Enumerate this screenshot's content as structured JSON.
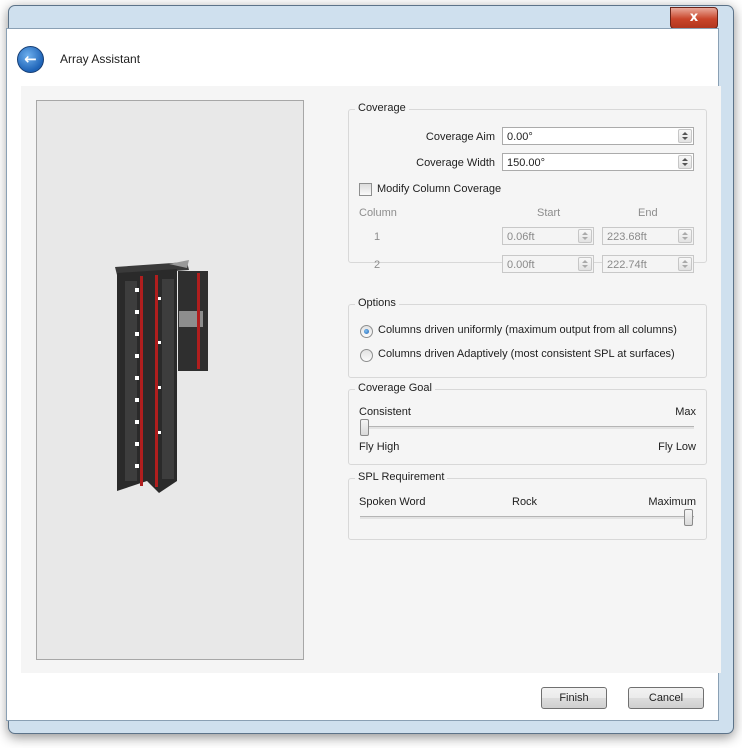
{
  "window": {
    "close_glyph": "x",
    "title": "Array Assistant",
    "back_glyph": "←"
  },
  "coverage": {
    "title": "Coverage",
    "aim_label": "Coverage Aim",
    "aim_value": "0.00°",
    "width_label": "Coverage Width",
    "width_value": "150.00°",
    "modify_label": "Modify Column Coverage",
    "modify_checked": false,
    "table": {
      "headers": [
        "Column",
        "Start",
        "End"
      ],
      "rows": [
        {
          "column": "1",
          "start": "0.06ft",
          "end": "223.68ft"
        },
        {
          "column": "2",
          "start": "0.00ft",
          "end": "222.74ft"
        }
      ]
    }
  },
  "options": {
    "title": "Options",
    "items": [
      {
        "label": "Columns driven uniformly (maximum output from all columns)",
        "selected": true
      },
      {
        "label": "Columns driven Adaptively (most consistent SPL at surfaces)",
        "selected": false
      }
    ]
  },
  "coverage_goal": {
    "title": "Coverage Goal",
    "top_left": "Consistent",
    "top_right": "Max",
    "bottom_left": "Fly High",
    "bottom_right": "Fly Low",
    "slider_fraction": 0.0
  },
  "spl": {
    "title": "SPL Requirement",
    "labels": [
      "Spoken Word",
      "Rock",
      "Maximum"
    ],
    "slider_fraction": 1.0
  },
  "buttons": {
    "finish": "Finish",
    "cancel": "Cancel"
  },
  "colors": {
    "accent_red": "#b01e1e",
    "speaker_body": "#2a2a2a"
  }
}
